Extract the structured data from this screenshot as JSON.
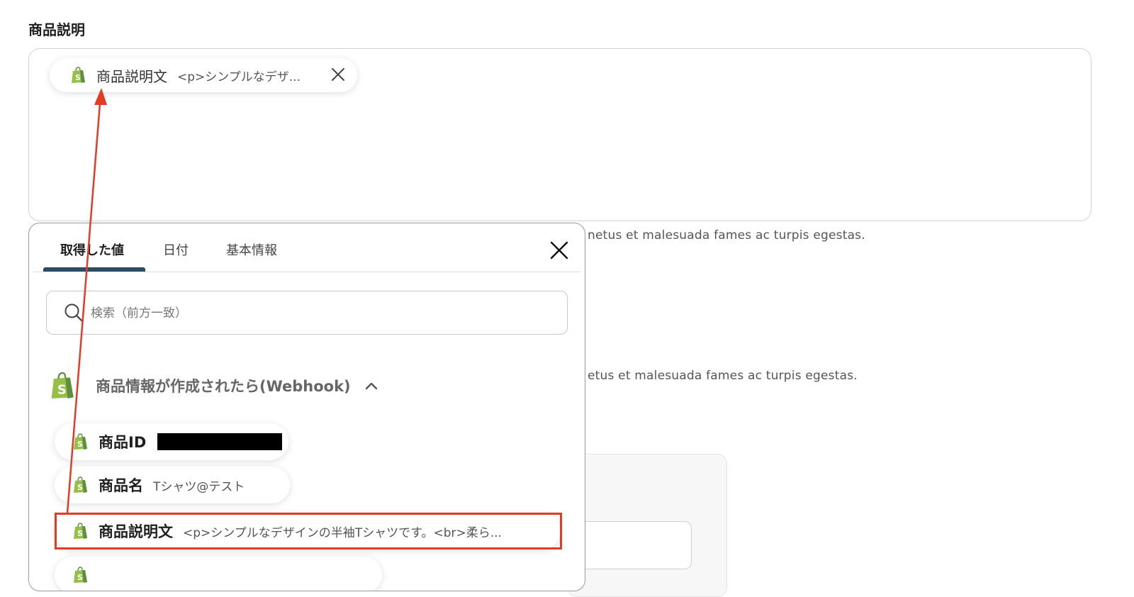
{
  "form": {
    "section_title": "商品説明",
    "top_chip": {
      "label": "商品説明文",
      "value": "<p>シンプルなデザ..."
    },
    "background_hint_1": "netus et malesuada fames ac turpis egestas.",
    "background_hint_2": "etus et malesuada fames ac turpis egestas."
  },
  "panel": {
    "tabs": [
      {
        "label": "取得した値",
        "active": true
      },
      {
        "label": "日付",
        "active": false
      },
      {
        "label": "基本情報",
        "active": false
      }
    ],
    "search": {
      "placeholder": "検索（前方一致）",
      "value": ""
    },
    "group": {
      "title": "商品情報が作成されたら(Webhook)",
      "expanded": true,
      "items": [
        {
          "label": "商品ID",
          "value": ""
        },
        {
          "label": "商品名",
          "value": "Tシャツ@テスト"
        },
        {
          "label": "商品説明文",
          "value": "<p>シンプルなデザインの半袖Tシャツです。<br>柔ら...",
          "highlighted": true
        },
        {
          "label": "",
          "value": ""
        }
      ]
    }
  },
  "icons": {
    "app_logo": "shopify-bag-icon",
    "close": "close-icon",
    "search": "search-icon",
    "collapse": "chevron-up-icon"
  },
  "colors": {
    "accent": "#2d4d5f",
    "highlight": "#e33b24",
    "shopify_green": "#95bf47"
  }
}
